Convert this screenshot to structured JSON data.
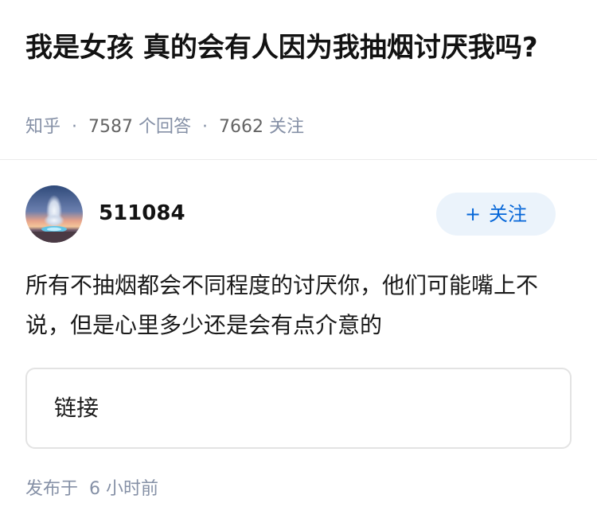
{
  "question": {
    "title": "我是女孩 真的会有人因为我抽烟讨厌我吗?",
    "source": "知乎",
    "separator": "·",
    "answer_count": "7587",
    "answer_count_label": "个回答",
    "follower_count": "7662",
    "follower_count_label": "关注"
  },
  "answer": {
    "author": {
      "name": "511084",
      "avatar_icon": "geyser-landscape-avatar"
    },
    "follow_button": {
      "icon": "+",
      "label": "关注"
    },
    "content": "所有不抽烟都会不同程度的讨厌你，他们可能嘴上不说，但是心里多少还是会有点介意的",
    "link_card_label": "链接",
    "publish_time": "发布于  6 小时前"
  },
  "colors": {
    "meta_text": "#8590a6",
    "follow_bg": "#ebf3fb",
    "follow_text": "#0566d8"
  }
}
